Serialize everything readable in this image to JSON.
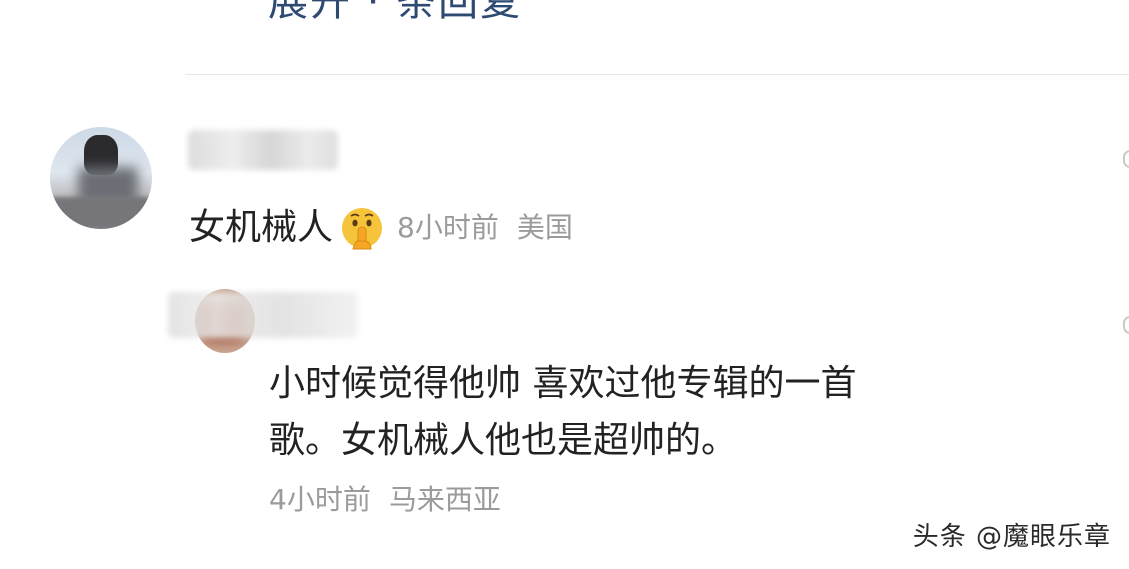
{
  "top_clipped_text": "展开 · 条回复",
  "comment": {
    "text": "女机械人",
    "emoji": "shushing-face",
    "time": "8小时前",
    "location": "美国"
  },
  "reply": {
    "line1": "小时候觉得他帅 喜欢过他专辑的一首",
    "line2": "歌。女机械人他也是超帅的。",
    "time": "4小时前",
    "location": "马来西亚"
  },
  "watermark": "头条 @魔眼乐章",
  "colors": {
    "text": "#222222",
    "meta": "#9b9b9b",
    "link": "#2e4a73",
    "emoji": "#f5c43a"
  }
}
